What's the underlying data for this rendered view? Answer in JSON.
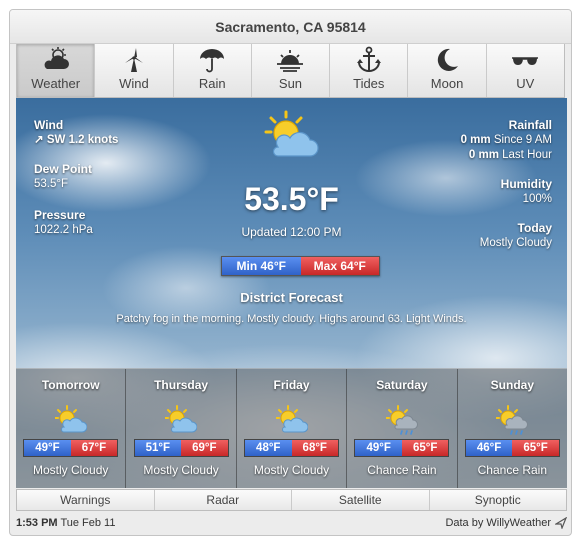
{
  "title": "Sacramento, CA 95814",
  "tabs": [
    {
      "label": "Weather",
      "icon": "weather-icon",
      "active": true
    },
    {
      "label": "Wind",
      "icon": "wind-icon"
    },
    {
      "label": "Rain",
      "icon": "umbrella-icon"
    },
    {
      "label": "Sun",
      "icon": "sun-icon"
    },
    {
      "label": "Tides",
      "icon": "anchor-icon"
    },
    {
      "label": "Moon",
      "icon": "moon-icon"
    },
    {
      "label": "UV",
      "icon": "sunglasses-icon"
    }
  ],
  "current": {
    "wind_label": "Wind",
    "wind_value": "SW 1.2 knots",
    "dewpoint_label": "Dew Point",
    "dewpoint_value": "53.5°F",
    "pressure_label": "Pressure",
    "pressure_value": "1022.2 hPa",
    "rainfall_label": "Rainfall",
    "rainfall_since9_amount": "0 mm",
    "rainfall_since9_text": "Since 9 AM",
    "rainfall_lasthour_amount": "0 mm",
    "rainfall_lasthour_text": "Last Hour",
    "humidity_label": "Humidity",
    "humidity_value": "100%",
    "today_label": "Today",
    "today_value": "Mostly Cloudy",
    "temperature": "53.5°F",
    "updated": "Updated 12:00 PM",
    "min": "Min 46°F",
    "max": "Max 64°F",
    "icon": "partly-cloudy-icon"
  },
  "district": {
    "title": "District Forecast",
    "text": "Patchy fog in the morning. Mostly cloudy. Highs around 63. Light Winds."
  },
  "forecast": [
    {
      "day": "Tomorrow",
      "min": "49°F",
      "max": "67°F",
      "condition": "Mostly Cloudy",
      "icon": "partly-cloudy-icon"
    },
    {
      "day": "Thursday",
      "min": "51°F",
      "max": "69°F",
      "condition": "Mostly Cloudy",
      "icon": "partly-cloudy-icon"
    },
    {
      "day": "Friday",
      "min": "48°F",
      "max": "68°F",
      "condition": "Mostly Cloudy",
      "icon": "partly-cloudy-icon"
    },
    {
      "day": "Saturday",
      "min": "49°F",
      "max": "65°F",
      "condition": "Chance Rain",
      "icon": "sun-rain-icon"
    },
    {
      "day": "Sunday",
      "min": "46°F",
      "max": "65°F",
      "condition": "Chance Rain",
      "icon": "sun-rain-icon"
    }
  ],
  "bottom_tabs": [
    "Warnings",
    "Radar",
    "Satellite",
    "Synoptic"
  ],
  "status": {
    "time": "1:53 PM",
    "date": "Tue Feb 11",
    "credit": "Data by WillyWeather"
  },
  "colors": {
    "min_pill": "#3f73d9",
    "max_pill": "#dc3b3b",
    "sky_top": "#3a6d9e",
    "sun": "#f5c518"
  }
}
